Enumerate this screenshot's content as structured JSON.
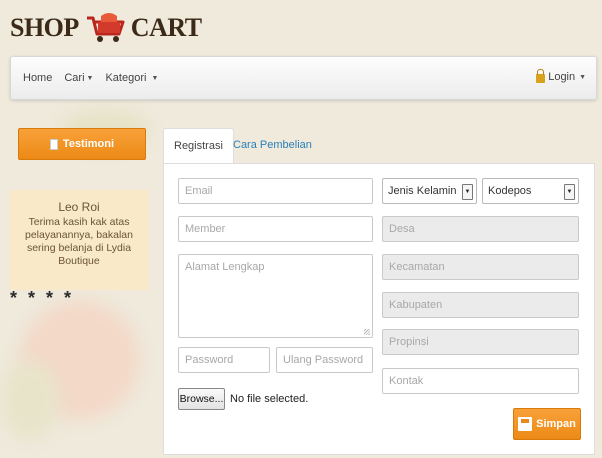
{
  "brand": {
    "word1": "SHOP",
    "word2": "CART"
  },
  "nav": {
    "home": "Home",
    "cari": "Cari",
    "kategori": "Kategori",
    "login": "Login"
  },
  "sidebar": {
    "testimoni_label": "Testimoni",
    "testimonial": {
      "name": "Leo Roi",
      "message": "Terima kasih kak atas pelayanannya, bakalan sering belanja di Lydia Boutique"
    },
    "stars": "* * * *"
  },
  "tabs": {
    "registrasi": "Registrasi",
    "cara_pembelian": "Cara Pembelian"
  },
  "form": {
    "email": "Email",
    "member": "Member",
    "alamat": "Alamat Lengkap",
    "password": "Password",
    "ulang_password": "Ulang Password",
    "jenis_kelamin": "Jenis Kelamin",
    "kodepos": "Kodepos",
    "desa": "Desa",
    "kecamatan": "Kecamatan",
    "kabupaten": "Kabupaten",
    "propinsi": "Propinsi",
    "kontak": "Kontak",
    "browse": "Browse...",
    "no_file": "No file selected.",
    "simpan": "Simpan"
  },
  "colors": {
    "accent_orange": "#f08d1c",
    "link_blue": "#2a7fb8"
  }
}
